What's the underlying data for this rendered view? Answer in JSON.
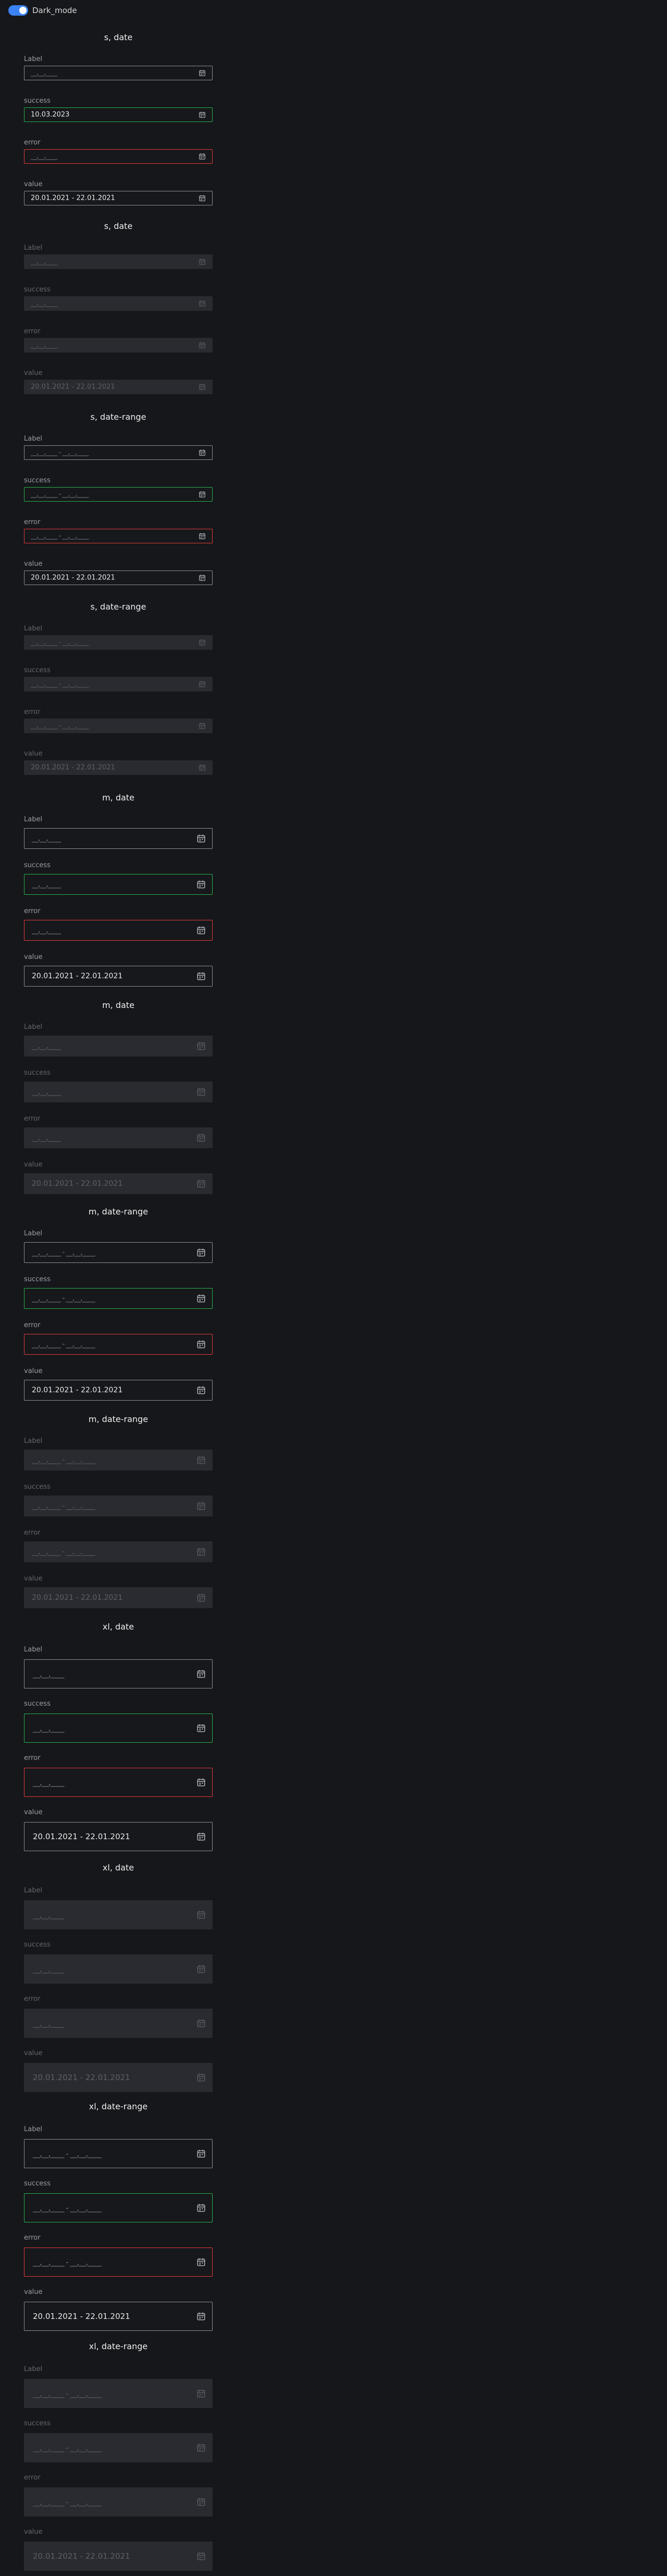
{
  "top": {
    "dark_mode_label": "Dark_mode",
    "dark_mode_on": true
  },
  "calendar_icon": "calendar-icon",
  "colors": {
    "bg": "#16171b",
    "success": "#27b24a",
    "error": "#e23b3b",
    "toggle": "#3b82f6"
  },
  "groups": [
    {
      "title": "s, date",
      "size": "s",
      "disabled": false,
      "fields": [
        {
          "label": "Label",
          "state": "default",
          "text": "__,__,____",
          "placeholder": true
        },
        {
          "label": "success",
          "state": "success",
          "text": "10.03.2023",
          "placeholder": false
        },
        {
          "label": "error",
          "state": "error",
          "text": "__,__,____",
          "placeholder": true
        },
        {
          "label": "value",
          "state": "default",
          "text": "20.01.2021 - 22.01.2021",
          "placeholder": false
        }
      ]
    },
    {
      "title": "s, date",
      "size": "s",
      "disabled": true,
      "fields": [
        {
          "label": "Label",
          "state": "default",
          "text": "__,__,____",
          "placeholder": true
        },
        {
          "label": "success",
          "state": "success",
          "text": "__,__,____",
          "placeholder": true
        },
        {
          "label": "error",
          "state": "error",
          "text": "__,__,____",
          "placeholder": true
        },
        {
          "label": "value",
          "state": "default",
          "text": "20.01.2021 - 22.01.2021",
          "placeholder": false
        }
      ]
    },
    {
      "title": "s, date-range",
      "size": "s",
      "disabled": false,
      "fields": [
        {
          "label": "Label",
          "state": "default",
          "text": "__,__,____ - __,__,____",
          "placeholder": true
        },
        {
          "label": "success",
          "state": "success",
          "text": "__,__,____ - __,__,____",
          "placeholder": true
        },
        {
          "label": "error",
          "state": "error",
          "text": "__,__,____ - __,__,____",
          "placeholder": true
        },
        {
          "label": "value",
          "state": "default",
          "text": "20.01.2021 - 22.01.2021",
          "placeholder": false
        }
      ]
    },
    {
      "title": "s, date-range",
      "size": "s",
      "disabled": true,
      "fields": [
        {
          "label": "Label",
          "state": "default",
          "text": "__,__,____ - __,__,____",
          "placeholder": true
        },
        {
          "label": "success",
          "state": "success",
          "text": "__,__,____ - __,__,____",
          "placeholder": true
        },
        {
          "label": "error",
          "state": "error",
          "text": "__,__,____ - __,__,____",
          "placeholder": true
        },
        {
          "label": "value",
          "state": "default",
          "text": "20.01.2021 - 22.01.2021",
          "placeholder": false
        }
      ]
    },
    {
      "title": "m, date",
      "size": "m",
      "disabled": false,
      "fields": [
        {
          "label": "Label",
          "state": "default",
          "text": "__,__,____",
          "placeholder": true
        },
        {
          "label": "success",
          "state": "success",
          "text": "__,__,____",
          "placeholder": true
        },
        {
          "label": "error",
          "state": "error",
          "text": "__,__,____",
          "placeholder": true
        },
        {
          "label": "value",
          "state": "default",
          "text": "20.01.2021 - 22.01.2021",
          "placeholder": false
        }
      ]
    },
    {
      "title": "m, date",
      "size": "m",
      "disabled": true,
      "fields": [
        {
          "label": "Label",
          "state": "default",
          "text": "__,__,____",
          "placeholder": true
        },
        {
          "label": "success",
          "state": "success",
          "text": "__,__,____",
          "placeholder": true
        },
        {
          "label": "error",
          "state": "error",
          "text": "__,__,____",
          "placeholder": true
        },
        {
          "label": "value",
          "state": "default",
          "text": "20.01.2021 - 22.01.2021",
          "placeholder": false
        }
      ]
    },
    {
      "title": "m, date-range",
      "size": "m",
      "disabled": false,
      "fields": [
        {
          "label": "Label",
          "state": "default",
          "text": "__,__,____ - __,__,____",
          "placeholder": true
        },
        {
          "label": "success",
          "state": "success",
          "text": "__,__,____ - __,__,____",
          "placeholder": true
        },
        {
          "label": "error",
          "state": "error",
          "text": "__,__,____ - __,__,____",
          "placeholder": true
        },
        {
          "label": "value",
          "state": "default",
          "text": "20.01.2021 - 22.01.2021",
          "placeholder": false
        }
      ]
    },
    {
      "title": "m, date-range",
      "size": "m",
      "disabled": true,
      "fields": [
        {
          "label": "Label",
          "state": "default",
          "text": "__,__,____ - __,__,____",
          "placeholder": true
        },
        {
          "label": "success",
          "state": "success",
          "text": "__,__,____ - __,__,____",
          "placeholder": true
        },
        {
          "label": "error",
          "state": "error",
          "text": "__,__,____ - __,__,____",
          "placeholder": true
        },
        {
          "label": "value",
          "state": "default",
          "text": "20.01.2021 - 22.01.2021",
          "placeholder": false
        }
      ]
    },
    {
      "title": "xl, date",
      "size": "xl",
      "disabled": false,
      "fields": [
        {
          "label": "Label",
          "state": "default",
          "text": "__,__,____",
          "placeholder": true
        },
        {
          "label": "success",
          "state": "success",
          "text": "__,__,____",
          "placeholder": true
        },
        {
          "label": "error",
          "state": "error",
          "text": "__,__,____",
          "placeholder": true
        },
        {
          "label": "value",
          "state": "default",
          "text": "20.01.2021 - 22.01.2021",
          "placeholder": false
        }
      ]
    },
    {
      "title": "xl, date",
      "size": "xl",
      "disabled": true,
      "fields": [
        {
          "label": "Label",
          "state": "default",
          "text": "__,__,____",
          "placeholder": true
        },
        {
          "label": "success",
          "state": "success",
          "text": "__,__,____",
          "placeholder": true
        },
        {
          "label": "error",
          "state": "error",
          "text": "__,__,____",
          "placeholder": true
        },
        {
          "label": "value",
          "state": "default",
          "text": "20.01.2021 - 22.01.2021",
          "placeholder": false
        }
      ]
    },
    {
      "title": "xl, date-range",
      "size": "xl",
      "disabled": false,
      "fields": [
        {
          "label": "Label",
          "state": "default",
          "text": "__,__,____ - __,__,____",
          "placeholder": true
        },
        {
          "label": "success",
          "state": "success",
          "text": "__,__,____ - __,__,____",
          "placeholder": true
        },
        {
          "label": "error",
          "state": "error",
          "text": "__,__,____ - __,__,____",
          "placeholder": true
        },
        {
          "label": "value",
          "state": "default",
          "text": "20.01.2021 - 22.01.2021",
          "placeholder": false
        }
      ]
    },
    {
      "title": "xl, date-range",
      "size": "xl",
      "disabled": true,
      "fields": [
        {
          "label": "Label",
          "state": "default",
          "text": "__,__,____ - __,__,____",
          "placeholder": true
        },
        {
          "label": "success",
          "state": "success",
          "text": "__,__,____ - __,__,____",
          "placeholder": true
        },
        {
          "label": "error",
          "state": "error",
          "text": "__,__,____ - __,__,____",
          "placeholder": true
        },
        {
          "label": "value",
          "state": "default",
          "text": "20.01.2021 - 22.01.2021",
          "placeholder": false
        }
      ]
    }
  ]
}
